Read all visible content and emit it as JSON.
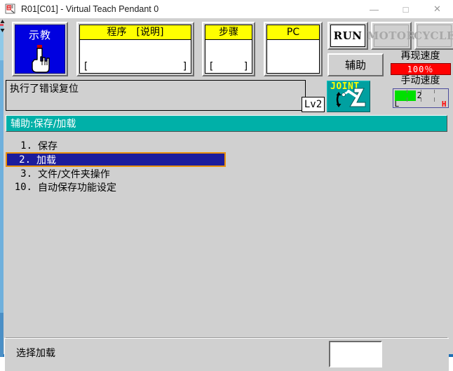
{
  "window": {
    "title": "R01[C01] - Virtual Teach Pendant 0",
    "icon": "robot-app-icon",
    "controls": {
      "minimize": "—",
      "maximize": "□",
      "close": "✕"
    }
  },
  "toprow": {
    "teach": {
      "label": "示教",
      "icon": "hand-pointer-icon",
      "active": true
    },
    "panels": [
      {
        "name": "program",
        "header": "程序　[说明]",
        "value": "",
        "bracket_left": "[",
        "bracket_right": "]"
      },
      {
        "name": "step",
        "header": "步骤",
        "value": "",
        "bracket_left": "[",
        "bracket_right": "]"
      },
      {
        "name": "pc",
        "header": "PC",
        "value": "",
        "bracket_left": "",
        "bracket_right": ""
      }
    ],
    "state_buttons": [
      {
        "name": "run",
        "label": "RUN",
        "enabled": true
      },
      {
        "name": "motor",
        "label": "MOTOR",
        "enabled": false
      },
      {
        "name": "cycle",
        "label": "CYCLE",
        "enabled": false
      }
    ],
    "aux_button": "辅助"
  },
  "speed": {
    "playback_title": "再现速度",
    "playback_value": "100％",
    "playback_color": "#ff0000",
    "manual_title": "手动速度",
    "manual_level": "2",
    "manual_low": "L",
    "manual_high": "H",
    "manual_fill_color": "#00e000",
    "manual_fill_percent": 40
  },
  "status": {
    "message": "执行了错误复位",
    "level_badge": "Lv2",
    "coord_mode": "JOINT",
    "coord_icon": "robot-arm-icon"
  },
  "section": {
    "title": "辅助:保存/加载",
    "accent_color": "#00b0a8"
  },
  "menu": {
    "selected_index": 1,
    "selection_border_color": "#e8900c",
    "selection_bg_color": "#1c1c9c",
    "items": [
      {
        "num": "1.",
        "label": "保存"
      },
      {
        "num": "2.",
        "label": "加载"
      },
      {
        "num": "3.",
        "label": "文件/文件夹操作"
      },
      {
        "num": "10.",
        "label": "自动保存功能设定"
      }
    ]
  },
  "bottom": {
    "prompt": "选择加载",
    "input_value": "",
    "input_placeholder": ""
  }
}
